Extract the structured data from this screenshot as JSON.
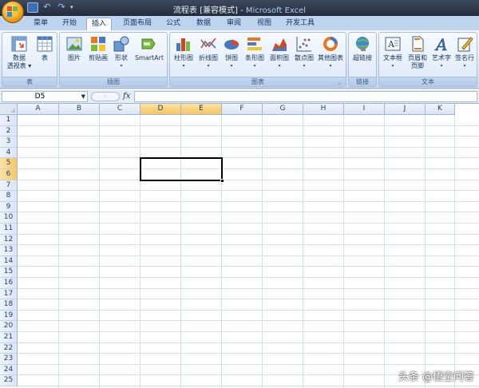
{
  "window": {
    "title_doc": "流程表",
    "title_mode": "[兼容模式]",
    "title_sep": " - ",
    "title_app": "Microsoft Excel"
  },
  "quick_access": [
    "save-icon",
    "undo-icon",
    "redo-icon",
    "customize-icon"
  ],
  "tabs": [
    {
      "label": "菜单",
      "active": false
    },
    {
      "label": "开始",
      "active": false
    },
    {
      "label": "插入",
      "active": true
    },
    {
      "label": "页面布局",
      "active": false
    },
    {
      "label": "公式",
      "active": false
    },
    {
      "label": "数据",
      "active": false
    },
    {
      "label": "审阅",
      "active": false
    },
    {
      "label": "视图",
      "active": false
    },
    {
      "label": "开发工具",
      "active": false
    }
  ],
  "ribbon": {
    "groups": [
      {
        "label": "表",
        "buttons": [
          {
            "label": "数据\n透视表 ▾",
            "icon": "pivot-table-icon"
          },
          {
            "label": "表",
            "icon": "table-icon"
          }
        ]
      },
      {
        "label": "插图",
        "buttons": [
          {
            "label": "图片",
            "icon": "picture-icon"
          },
          {
            "label": "剪贴画",
            "icon": "clip-art-icon"
          },
          {
            "label": "形状",
            "icon": "shapes-icon"
          },
          {
            "label": "SmartArt",
            "icon": "smartart-icon"
          }
        ]
      },
      {
        "label": "图表",
        "buttons": [
          {
            "label": "柱形图",
            "icon": "column-chart-icon"
          },
          {
            "label": "折线图",
            "icon": "line-chart-icon"
          },
          {
            "label": "饼图",
            "icon": "pie-chart-icon"
          },
          {
            "label": "条形图",
            "icon": "bar-chart-icon"
          },
          {
            "label": "面积图",
            "icon": "area-chart-icon"
          },
          {
            "label": "散点图",
            "icon": "scatter-chart-icon"
          },
          {
            "label": "其他图表",
            "icon": "other-charts-icon"
          }
        ]
      },
      {
        "label": "链接",
        "buttons": [
          {
            "label": "超链接",
            "icon": "hyperlink-icon"
          }
        ]
      },
      {
        "label": "文本",
        "buttons": [
          {
            "label": "文本框",
            "icon": "text-box-icon"
          },
          {
            "label": "页眉和\n页脚",
            "icon": "header-footer-icon"
          },
          {
            "label": "艺术字",
            "icon": "wordart-icon"
          },
          {
            "label": "签名行",
            "icon": "signature-line-icon"
          }
        ]
      }
    ]
  },
  "formula_bar": {
    "name_box": "D5",
    "fx": "fx",
    "formula": ""
  },
  "grid": {
    "columns": [
      "A",
      "B",
      "C",
      "D",
      "E",
      "F",
      "G",
      "H",
      "I",
      "J",
      "K"
    ],
    "rows": [
      "1",
      "2",
      "3",
      "4",
      "5",
      "6",
      "7",
      "8",
      "9",
      "10",
      "11",
      "12",
      "13",
      "14",
      "15",
      "16",
      "17",
      "18",
      "19",
      "20",
      "21",
      "22",
      "23",
      "24",
      "25"
    ],
    "selected_columns": [
      "D",
      "E"
    ],
    "selected_rows": [
      "5",
      "6"
    ],
    "active_cell": "D5"
  },
  "watermark": "头条 @悟空问答"
}
